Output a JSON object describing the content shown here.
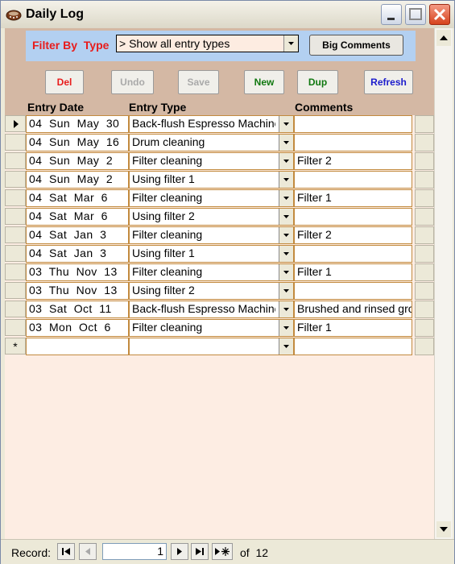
{
  "window": {
    "title": "Daily Log"
  },
  "filter": {
    "label": "Filter By  Type",
    "value": "> Show all entry types",
    "big_comments_label": "Big Comments"
  },
  "actions": {
    "del": "Del",
    "undo": "Undo",
    "save": "Save",
    "new": "New",
    "dup": "Dup",
    "refresh": "Refresh"
  },
  "colors": {
    "del": "#e81c1c",
    "disabled": "#a9a9a9",
    "new": "#107810",
    "dup": "#107810",
    "refresh": "#1c1ccc",
    "filter_label": "#e81c1c"
  },
  "columns": {
    "date": "Entry Date",
    "type": "Entry Type",
    "comments": "Comments"
  },
  "rows": [
    {
      "date": "04  Sun  May  30",
      "type": "Back-flush Espresso Machine",
      "comments": ""
    },
    {
      "date": "04  Sun  May  16",
      "type": "Drum cleaning",
      "comments": ""
    },
    {
      "date": "04  Sun  May  2",
      "type": "Filter cleaning",
      "comments": "Filter 2"
    },
    {
      "date": "04  Sun  May  2",
      "type": "Using filter 1",
      "comments": ""
    },
    {
      "date": "04  Sat  Mar  6",
      "type": "Filter cleaning",
      "comments": "Filter 1"
    },
    {
      "date": "04  Sat  Mar  6",
      "type": "Using filter 2",
      "comments": ""
    },
    {
      "date": "04  Sat  Jan  3",
      "type": "Filter cleaning",
      "comments": "Filter 2"
    },
    {
      "date": "04  Sat  Jan  3",
      "type": "Using filter 1",
      "comments": ""
    },
    {
      "date": "03  Thu  Nov  13",
      "type": "Filter cleaning",
      "comments": "Filter 1"
    },
    {
      "date": "03  Thu  Nov  13",
      "type": "Using filter 2",
      "comments": ""
    },
    {
      "date": "03  Sat  Oct  11",
      "type": "Back-flush Espresso Machine",
      "comments": "Brushed and rinsed group"
    },
    {
      "date": "03  Mon  Oct  6",
      "type": "Filter cleaning",
      "comments": "Filter 1"
    },
    {
      "date": "",
      "type": "",
      "comments": "",
      "new_record": "*"
    }
  ],
  "navigation": {
    "record_label": "Record:",
    "current": "1",
    "of_label": "of  12"
  }
}
